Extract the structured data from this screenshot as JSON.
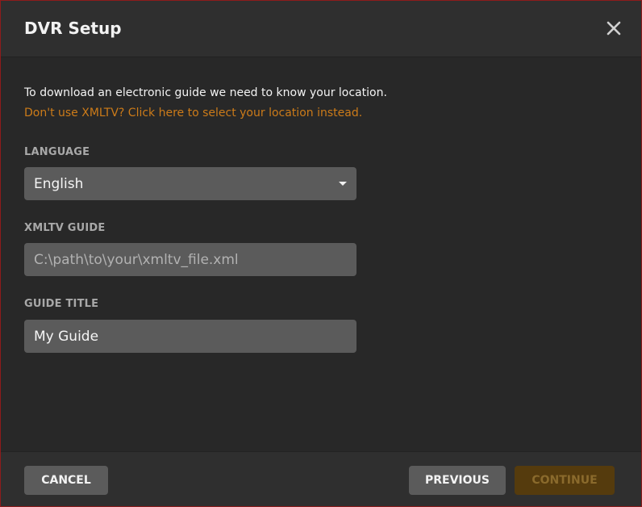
{
  "dialog": {
    "title": "DVR Setup",
    "close_icon": "close-icon"
  },
  "content": {
    "intro_text": "To download an electronic guide we need to know your location.",
    "link_text": "Don't use XMLTV? Click here to select your location instead."
  },
  "fields": {
    "language": {
      "label": "LANGUAGE",
      "value": "English",
      "icon": "chevron-down-icon"
    },
    "xmltv_guide": {
      "label": "XMLTV GUIDE",
      "value": "",
      "placeholder": "C:\\path\\to\\your\\xmltv_file.xml"
    },
    "guide_title": {
      "label": "GUIDE TITLE",
      "value": "My Guide",
      "placeholder": ""
    }
  },
  "footer": {
    "cancel_label": "CANCEL",
    "previous_label": "PREVIOUS",
    "continue_label": "CONTINUE"
  },
  "colors": {
    "background": "#282828",
    "header_footer": "#2f2f2f",
    "link": "#cc7b19",
    "field": "#5b5b5b",
    "button": "#5b5b5b",
    "disabled_button": "#553b0d"
  }
}
